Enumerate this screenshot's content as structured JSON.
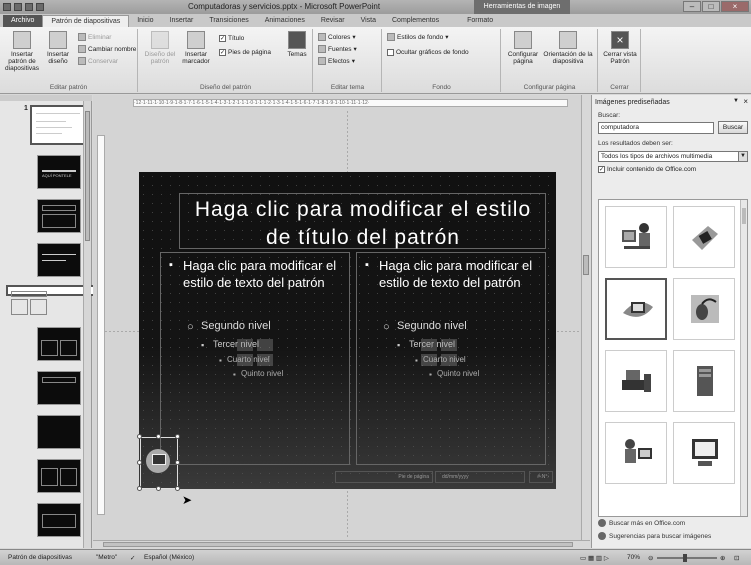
{
  "window": {
    "title": "Computadoras y servicios.pptx - Microsoft PowerPoint",
    "contextual_tab_group": "Herramientas de imagen"
  },
  "tabs": [
    {
      "label": "Archivo"
    },
    {
      "label": "Patrón de diapositivas"
    },
    {
      "label": "Inicio"
    },
    {
      "label": "Insertar"
    },
    {
      "label": "Transiciones"
    },
    {
      "label": "Animaciones"
    },
    {
      "label": "Revisar"
    },
    {
      "label": "Vista"
    },
    {
      "label": "Complementos"
    },
    {
      "label": "Formato"
    }
  ],
  "ribbon": {
    "groups": {
      "editar_patron": "Editar patrón",
      "diseno_patron": "Diseño del patrón",
      "editar_tema": "Editar tema",
      "fondo": "Fondo",
      "configurar_pagina": "Configurar página",
      "cerrar": "Cerrar"
    },
    "insertar_patron": "Insertar patrón de diapositivas",
    "insertar_diseno": "Insertar diseño",
    "eliminar": "Eliminar",
    "cambiar_nombre": "Cambiar nombre",
    "conservar": "Conservar",
    "diseno_del_patron": "Diseño del patrón",
    "insertar_marcador": "Insertar marcador",
    "titulo": "Título",
    "pies_de_pagina": "Pies de página",
    "temas": "Temas",
    "colores": "Colores",
    "fuentes": "Fuentes",
    "efectos": "Efectos",
    "estilos_fondo": "Estilos de fondo",
    "ocultar_graficos": "Ocultar gráficos de fondo",
    "configurar_pagina": "Configurar página",
    "orientacion": "Orientación de la diapositiva",
    "cerrar_vista": "Cerrar vista Patrón"
  },
  "ruler": {
    "labels": "·12·1·11·1·10·1·9·1·8·1·7·1·6·1·5·1·4·1·3·1·2·1·1·1·0·1·1·1·2·1·3·1·4·1·5·1·6·1·7·1·8·1·9·1·10·1·11·1·12·"
  },
  "slide": {
    "title": "Haga clic para modificar el estilo de título del patrón",
    "left": {
      "level1": "Haga clic para modificar el estilo de texto del patrón",
      "level2": "Segundo nivel",
      "level3": "Tercer nivel",
      "level4": "Cuarto nivel",
      "level5": "Quinto nivel"
    },
    "right": {
      "level1": "Haga clic para modificar el estilo de texto del patrón",
      "level2": "Segundo nivel",
      "level3": "Tercer nivel",
      "level4": "Cuarto nivel",
      "level5": "Quinto nivel"
    },
    "footer": "Pie de página",
    "date": "dd/mm/yyyy",
    "number": "#‹N°›"
  },
  "thumbnails": {
    "first_number": "1",
    "second_title": "AQUÍ PONTELE"
  },
  "clipart_pane": {
    "title": "Imágenes prediseñadas",
    "search_label": "Buscar:",
    "search_value": "computadora",
    "search_button": "Buscar",
    "results_label": "Los resultados deben ser:",
    "results_type": "Todos los tipos de archivos multimedia",
    "include_office": "Incluir contenido de Office.com",
    "link_more": "Buscar más en Office.com",
    "link_tips": "Sugerencias para buscar imágenes",
    "results": [
      {
        "icon": "woman-at-computer-clip"
      },
      {
        "icon": "floppy-disk-clip"
      },
      {
        "icon": "computer-swirl-clip"
      },
      {
        "icon": "mouse-cable-clip"
      },
      {
        "icon": "desktop-tower-clip"
      },
      {
        "icon": "computer-tower-clip"
      },
      {
        "icon": "man-at-computer-clip"
      },
      {
        "icon": "monitor-computer-clip"
      }
    ]
  },
  "statusbar": {
    "view": "Patrón de diapositivas",
    "theme": "\"Metro\"",
    "language": "Español (México)",
    "zoom": "70%"
  }
}
